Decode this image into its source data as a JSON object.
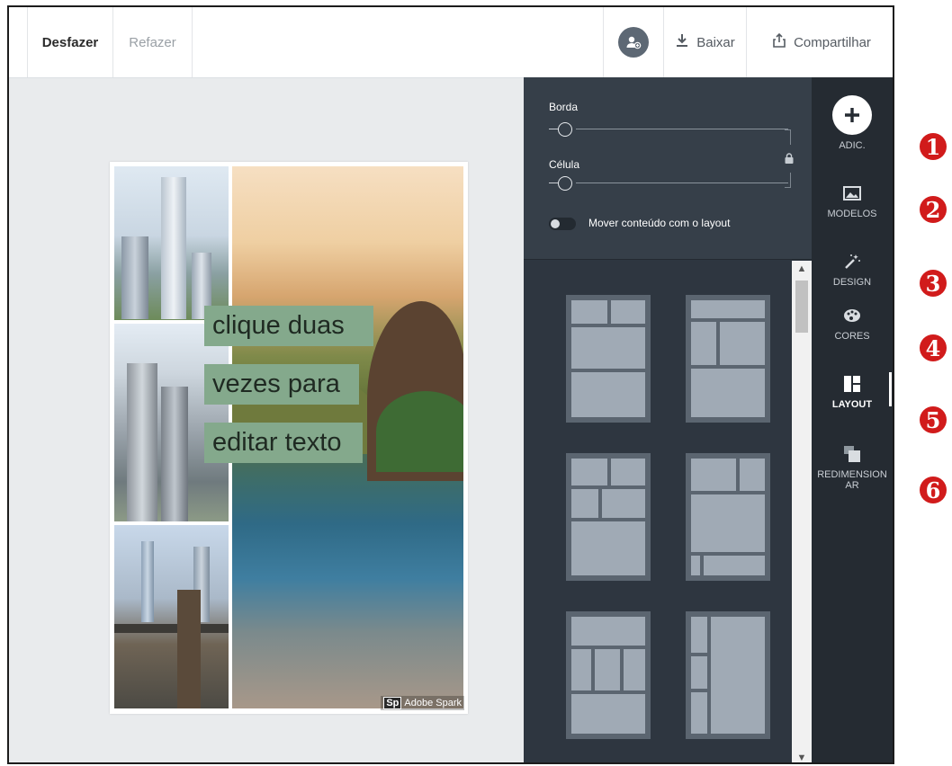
{
  "toolbar": {
    "undo_label": "Desfazer",
    "redo_label": "Refazer",
    "download_label": "Baixar",
    "share_label": "Compartilhar"
  },
  "canvas": {
    "text_lines": [
      "clique duas",
      "vezes para",
      "editar texto"
    ],
    "badge_logo": "Sp",
    "badge_text": "Adobe Spark"
  },
  "settings": {
    "border_label": "Borda",
    "cell_label": "Célula",
    "toggle_label": "Mover conteúdo com o layout"
  },
  "nav": {
    "items": [
      {
        "label": "ADIC."
      },
      {
        "label": "MODELOS"
      },
      {
        "label": "DESIGN"
      },
      {
        "label": "CORES"
      },
      {
        "label": "LAYOUT"
      },
      {
        "label": "REDIMENSIONAR"
      }
    ]
  },
  "callouts": [
    "1",
    "2",
    "3",
    "4",
    "5",
    "6"
  ],
  "colors": {
    "accent_red": "#d11b1b",
    "panel_bg": "#2e3640",
    "nav_bg": "#252b32",
    "text_box": "#84a98c"
  }
}
